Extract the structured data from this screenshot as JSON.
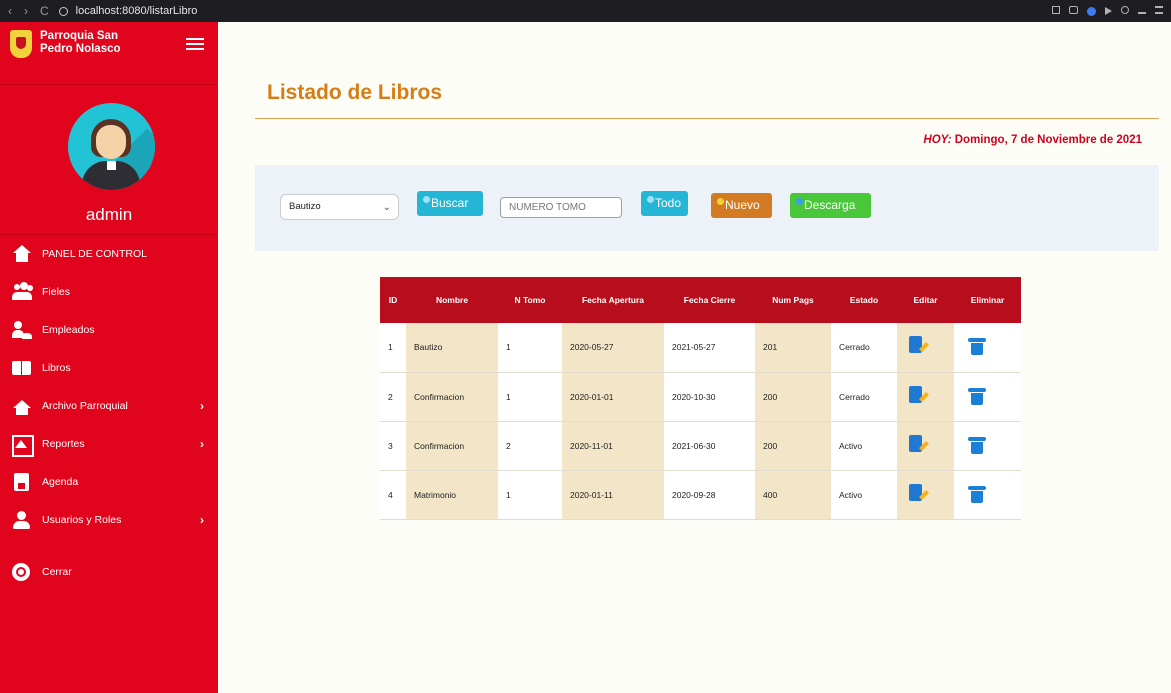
{
  "browser": {
    "url": "localhost:8080/listarLibro",
    "back_glyph": "‹",
    "forward_glyph": "›",
    "reload_glyph": "C"
  },
  "sidebar": {
    "brand": "Parroquia San Pedro Nolasco",
    "username": "admin",
    "items": [
      {
        "label": "PANEL DE CONTROL",
        "icon": "home-icon"
      },
      {
        "label": "Fieles",
        "icon": "people-icon"
      },
      {
        "label": "Empleados",
        "icon": "employees-icon"
      },
      {
        "label": "Libros",
        "icon": "book-icon"
      },
      {
        "label": "Archivo Parroquial",
        "icon": "church-icon",
        "chevron": "›"
      },
      {
        "label": "Reportes",
        "icon": "report-icon",
        "chevron": "›"
      },
      {
        "label": "Agenda",
        "icon": "agenda-icon"
      },
      {
        "label": "Usuarios y Roles",
        "icon": "user-icon",
        "chevron": "›"
      },
      {
        "label": "Cerrar",
        "icon": "power-icon"
      }
    ]
  },
  "main": {
    "title": "Listado de Libros",
    "today_prefix": "HOY:",
    "today_value": " Domingo, 7 de Noviembre de 2021",
    "toolbar": {
      "select_value": "Bautizo",
      "buscar_label": "Buscar",
      "tomo_placeholder": "NUMERO TOMO",
      "todo_label": "Todo",
      "nuevo_label": "Nuevo",
      "descarga_label": "Descarga"
    },
    "table": {
      "headers": [
        "ID",
        "Nombre",
        "N Tomo",
        "Fecha Apertura",
        "Fecha Cierre",
        "Num Pags",
        "Estado",
        "Editar",
        "Eliminar"
      ],
      "rows": [
        {
          "id": "1",
          "nombre": "Bautizo",
          "tomo": "1",
          "apertura": "2020-05-27",
          "cierre": "2021-05-27",
          "pags": "201",
          "estado": "Cerrado"
        },
        {
          "id": "2",
          "nombre": "Confirmacion",
          "tomo": "1",
          "apertura": "2020-01-01",
          "cierre": "2020-10-30",
          "pags": "200",
          "estado": "Cerrado"
        },
        {
          "id": "3",
          "nombre": "Confirmacion",
          "tomo": "2",
          "apertura": "2020-11-01",
          "cierre": "2021-06-30",
          "pags": "200",
          "estado": "Activo"
        },
        {
          "id": "4",
          "nombre": "Matrimonio",
          "tomo": "1",
          "apertura": "2020-01-11",
          "cierre": "2020-09-28",
          "pags": "400",
          "estado": "Activo"
        }
      ]
    }
  },
  "colors": {
    "sidebar": "#e0041c",
    "title": "#d77d14",
    "today": "#d0021b",
    "table_header": "#b80d1c",
    "buscar": "#25b5d5",
    "nuevo": "#d27b22",
    "descarga": "#4ac63a"
  }
}
